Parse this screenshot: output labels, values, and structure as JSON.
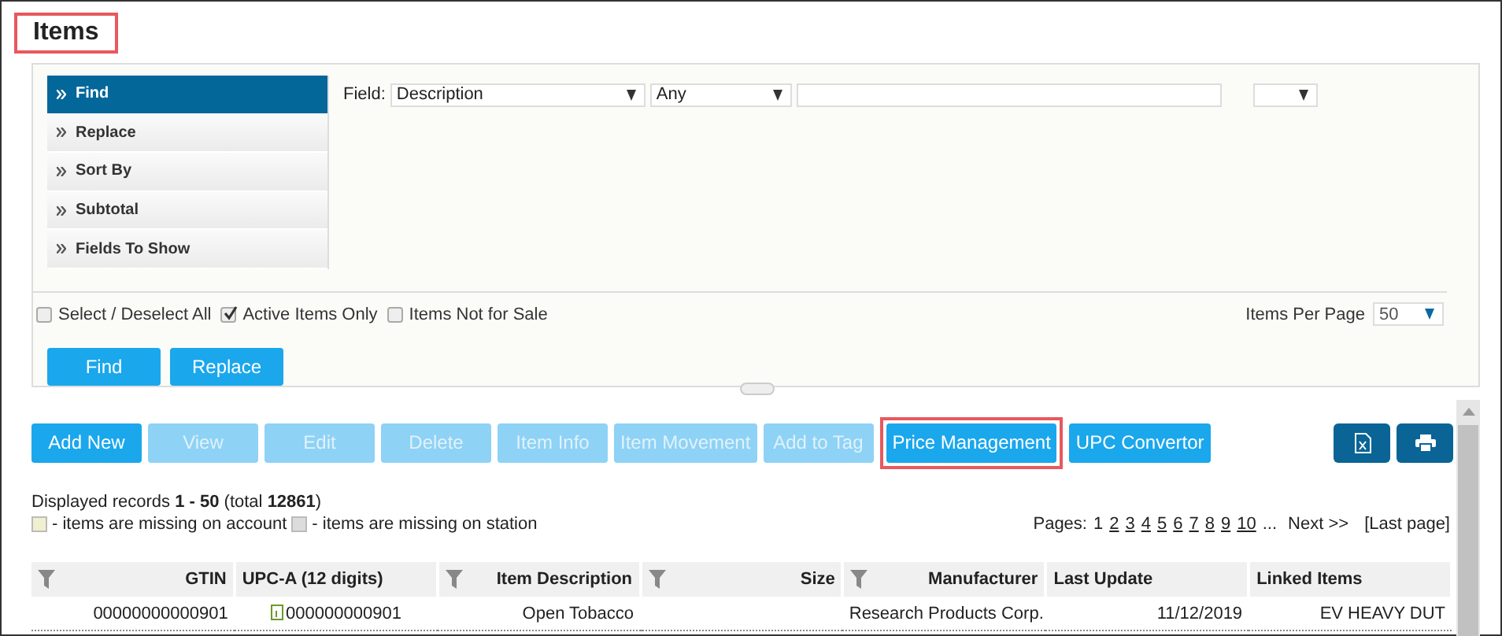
{
  "title": {
    "text": "Items",
    "highlighted": true
  },
  "search": {
    "nav": [
      {
        "label": "Find",
        "selected": true
      },
      {
        "label": "Replace",
        "selected": false
      },
      {
        "label": "Sort By",
        "selected": false
      },
      {
        "label": "Subtotal",
        "selected": false
      },
      {
        "label": "Fields To Show",
        "selected": false
      }
    ],
    "field_label": "Field:",
    "field_select": "Description",
    "match_select": "Any",
    "options": [
      {
        "label": "Select / Deselect All",
        "checked": false
      },
      {
        "label": "Active Items Only",
        "checked": true
      },
      {
        "label": "Items Not for Sale",
        "checked": false
      }
    ],
    "per_page_label": "Items Per Page",
    "per_page": "50",
    "buttons": [
      "Find",
      "Replace"
    ]
  },
  "toolbar": [
    {
      "label": "Add New",
      "disabled": false,
      "highlighted": false
    },
    {
      "label": "View",
      "disabled": true,
      "highlighted": false
    },
    {
      "label": "Edit",
      "disabled": true,
      "highlighted": false
    },
    {
      "label": "Delete",
      "disabled": true,
      "highlighted": false
    },
    {
      "label": "Item Info",
      "disabled": true,
      "highlighted": false
    },
    {
      "label": "Item Movement",
      "disabled": true,
      "highlighted": false
    },
    {
      "label": "Add to Tag",
      "disabled": true,
      "highlighted": false
    },
    {
      "label": "Price Management",
      "disabled": false,
      "highlighted": true
    },
    {
      "label": "UPC Convertor",
      "disabled": false,
      "highlighted": false
    }
  ],
  "records": {
    "text": "Displayed records **1 - 50** (total **12861**)",
    "legend": [
      {
        "label": "- items are missing on account",
        "color": "#f0efd0"
      },
      {
        "label": "- items are missing on station",
        "color": "#dcdcdc"
      }
    ]
  },
  "pager": {
    "label": "Pages:",
    "pages": [
      {
        "label": "1",
        "selected": true
      },
      {
        "label": "2",
        "selected": false
      },
      {
        "label": "3",
        "selected": false
      },
      {
        "label": "4",
        "selected": false
      },
      {
        "label": "5",
        "selected": false
      },
      {
        "label": "6",
        "selected": false
      },
      {
        "label": "7",
        "selected": false
      },
      {
        "label": "8",
        "selected": false
      },
      {
        "label": "9",
        "selected": false
      },
      {
        "label": "10",
        "selected": false
      }
    ],
    "ellipsis": "...",
    "next": "Next >>",
    "last": "[Last page]"
  },
  "table": {
    "columns": [
      {
        "label": "GTIN",
        "filter": true
      },
      {
        "label": "UPC-A (12 digits)",
        "filter": false
      },
      {
        "label": "Item Description",
        "filter": true
      },
      {
        "label": "Size",
        "filter": true
      },
      {
        "label": "Manufacturer",
        "filter": true
      },
      {
        "label": "Last Update",
        "filter": false
      },
      {
        "label": "Linked Items",
        "filter": false
      }
    ],
    "rows": [
      {
        "cells": [
          {
            "text": "00000000000901"
          },
          {
            "text": "000000000901",
            "info": true
          },
          {
            "text": "Open Tobacco"
          },
          {
            "text": ""
          },
          {
            "text": "Research Products Corp."
          },
          {
            "text": "11/12/2019"
          },
          {
            "text": "EV HEAVY DUT"
          }
        ]
      }
    ]
  }
}
